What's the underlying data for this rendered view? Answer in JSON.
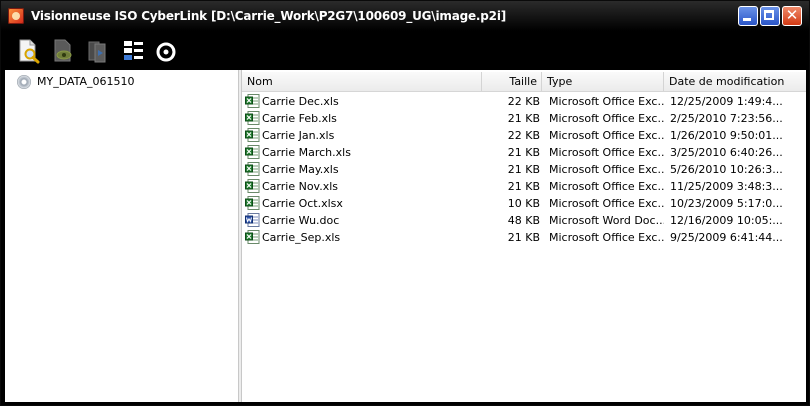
{
  "window": {
    "title": "Visionneuse ISO CyberLink [D:\\Carrie_Work\\P2G7\\100609_UG\\image.p2i]",
    "close_glyph": "✕"
  },
  "toolbar": {
    "tools": [
      {
        "name": "search-document-icon"
      },
      {
        "name": "view-icon"
      },
      {
        "name": "extract-icon"
      },
      {
        "name": "properties-icon"
      },
      {
        "name": "disc-burn-icon"
      }
    ]
  },
  "tree": {
    "root_label": "MY_DATA_061510",
    "root_icon": "disc-icon"
  },
  "list": {
    "columns": {
      "name": "Nom",
      "size": "Taille",
      "type": "Type",
      "date": "Date de modification"
    },
    "rows": [
      {
        "icon": "excel",
        "name": "Carrie Dec.xls",
        "size": "22 KB",
        "type": "Microsoft Office Exc...",
        "date": "12/25/2009 1:49:4..."
      },
      {
        "icon": "excel",
        "name": "Carrie Feb.xls",
        "size": "21 KB",
        "type": "Microsoft Office Exc...",
        "date": "2/25/2010 7:23:56..."
      },
      {
        "icon": "excel",
        "name": "Carrie Jan.xls",
        "size": "22 KB",
        "type": "Microsoft Office Exc...",
        "date": "1/26/2010 9:50:01..."
      },
      {
        "icon": "excel",
        "name": "Carrie March.xls",
        "size": "21 KB",
        "type": "Microsoft Office Exc...",
        "date": "3/25/2010 6:40:26..."
      },
      {
        "icon": "excel",
        "name": "Carrie May.xls",
        "size": "21 KB",
        "type": "Microsoft Office Exc...",
        "date": "5/26/2010 10:26:3..."
      },
      {
        "icon": "excel",
        "name": "Carrie Nov.xls",
        "size": "21 KB",
        "type": "Microsoft Office Exc...",
        "date": "11/25/2009 3:48:3..."
      },
      {
        "icon": "excel",
        "name": "Carrie Oct.xlsx",
        "size": "10 KB",
        "type": "Microsoft Office Exc...",
        "date": "10/23/2009 5:17:0..."
      },
      {
        "icon": "word",
        "name": "Carrie Wu.doc",
        "size": "48 KB",
        "type": "Microsoft Word Doc...",
        "date": "12/16/2009 10:05:..."
      },
      {
        "icon": "excel",
        "name": "Carrie_Sep.xls",
        "size": "21 KB",
        "type": "Microsoft Office Exc...",
        "date": "9/25/2009 6:41:44..."
      }
    ]
  }
}
